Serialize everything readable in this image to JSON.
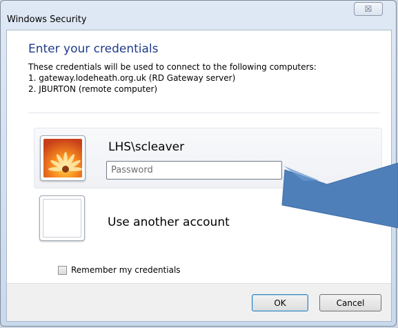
{
  "window": {
    "title": "Windows Security",
    "close_glyph": "☒"
  },
  "dialog": {
    "heading": "Enter your credentials",
    "description_lines": [
      "These credentials will be used to connect to the following computers:",
      "1. gateway.lodeheath.org.uk (RD Gateway server)",
      "2. JBURTON (remote computer)"
    ]
  },
  "account": {
    "username": "LHS\\scleaver",
    "password_placeholder": "Password",
    "avatar_icon": "flower-avatar-icon"
  },
  "other_account": {
    "label": "Use another account",
    "avatar_icon": "blank-avatar-icon"
  },
  "remember": {
    "label": "Remember my credentials",
    "checked": false
  },
  "buttons": {
    "ok": "OK",
    "cancel": "Cancel"
  },
  "annotation": {
    "color": "#4f7fb8"
  }
}
